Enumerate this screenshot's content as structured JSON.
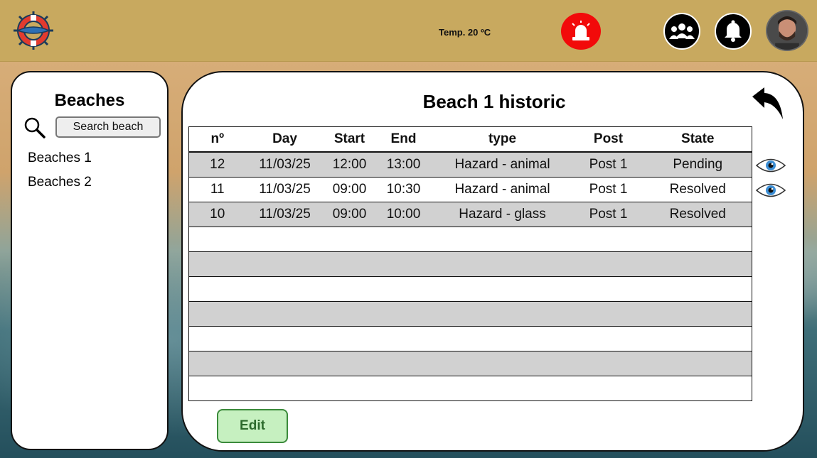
{
  "header": {
    "temperature": "Temp. 20 ºC"
  },
  "sidebar": {
    "title": "Beaches",
    "search_label": "Search beach",
    "items": [
      {
        "label": "Beaches 1"
      },
      {
        "label": "Beaches 2"
      }
    ]
  },
  "main": {
    "title": "Beach 1 historic",
    "columns": [
      "nº",
      "Day",
      "Start",
      "End",
      "type",
      "Post",
      "State"
    ],
    "rows": [
      {
        "n": "12",
        "day": "11/03/25",
        "start": "12:00",
        "end": "13:00",
        "type": "Hazard - animal",
        "post": "Post 1",
        "state": "Pending"
      },
      {
        "n": "11",
        "day": "11/03/25",
        "start": "09:00",
        "end": "10:30",
        "type": "Hazard - animal",
        "post": "Post 1",
        "state": "Resolved"
      },
      {
        "n": "10",
        "day": "11/03/25",
        "start": "09:00",
        "end": "10:00",
        "type": "Hazard - glass",
        "post": "Post 1",
        "state": "Resolved"
      }
    ],
    "edit_label": "Edit"
  },
  "icons": {
    "logo": "lifebuoy-logo-icon",
    "alarm": "siren-icon",
    "group": "group-icon",
    "bell": "bell-icon",
    "avatar": "user-avatar",
    "search": "search-icon",
    "back": "back-arrow-icon",
    "view": "eye-icon"
  },
  "colors": {
    "header_bg": "#c8a95f",
    "alarm": "#f20a0a",
    "row_grey": "#d1d1d1",
    "edit_bg": "#c6f0c0",
    "edit_text": "#2d6b2d"
  }
}
